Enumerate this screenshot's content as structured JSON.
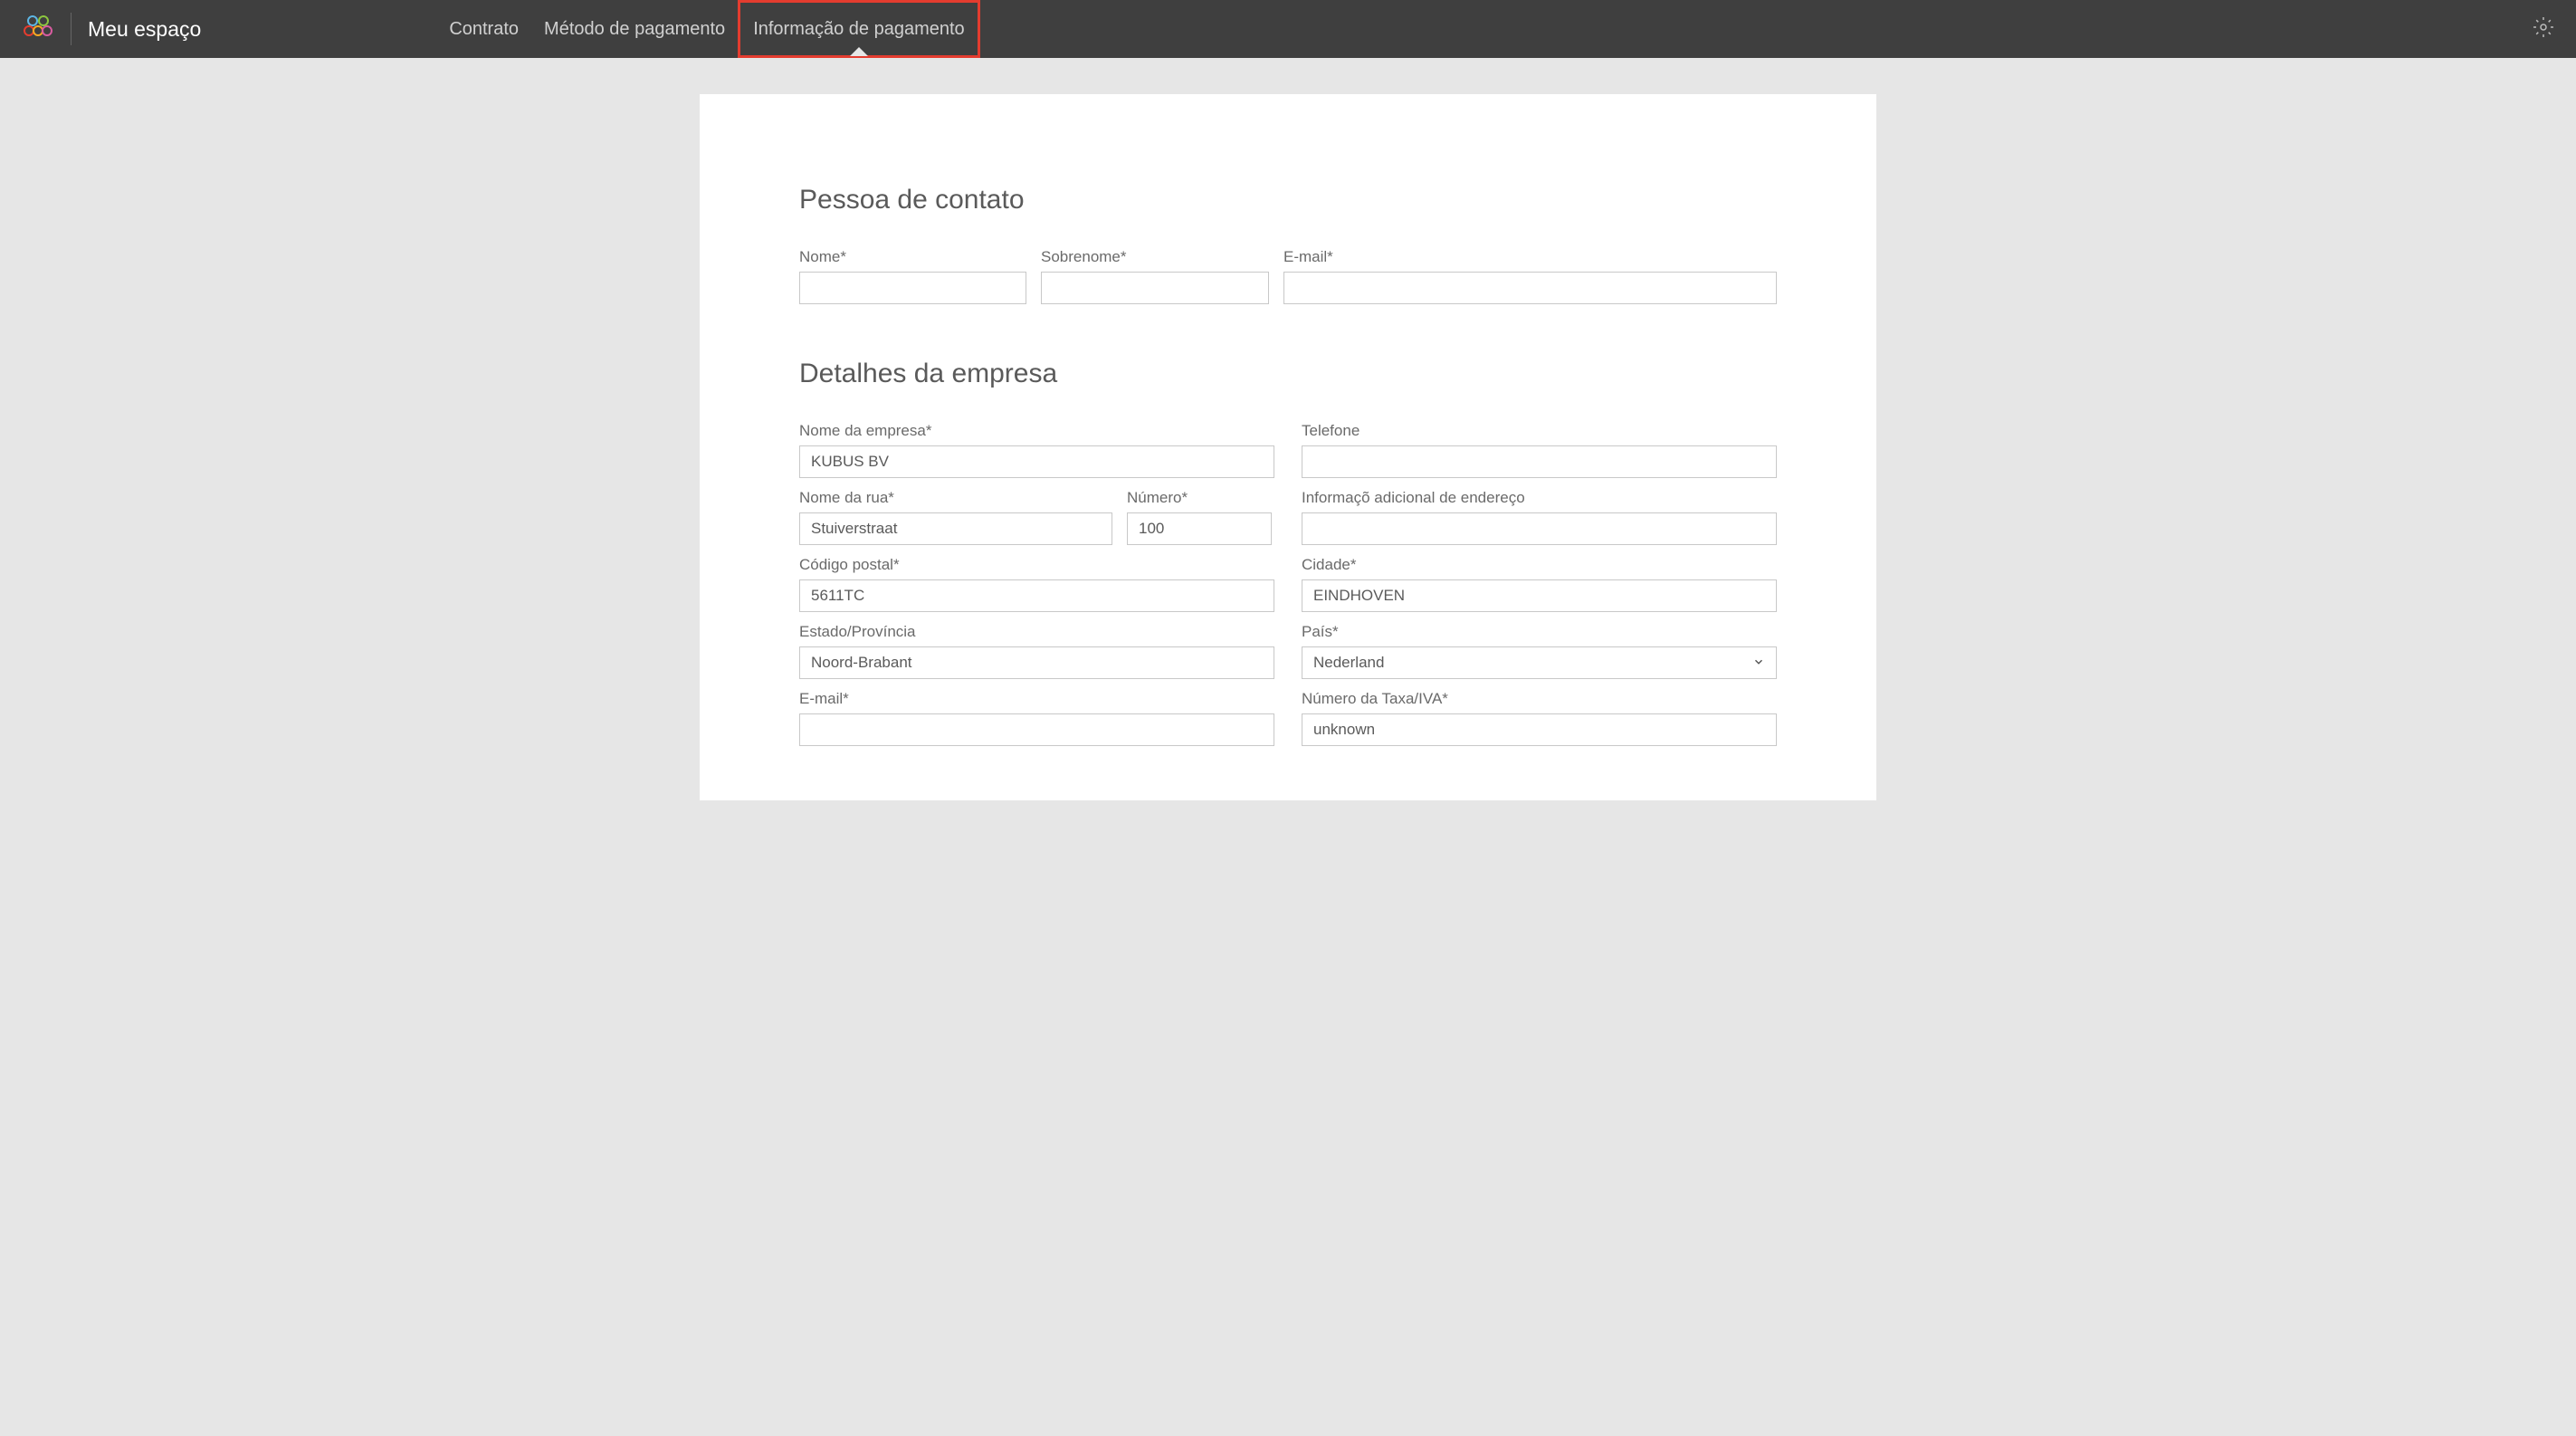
{
  "header": {
    "title": "Meu espaço",
    "tabs": [
      {
        "label": "Contrato",
        "active": false,
        "highlighted": false
      },
      {
        "label": "Método de pagamento",
        "active": false,
        "highlighted": false
      },
      {
        "label": "Informação de pagamento",
        "active": true,
        "highlighted": true
      }
    ]
  },
  "sections": {
    "contact": {
      "title": "Pessoa de contato",
      "fields": {
        "firstName": {
          "label": "Nome*",
          "value": ""
        },
        "lastName": {
          "label": "Sobrenome*",
          "value": ""
        },
        "email": {
          "label": "E-mail*",
          "value": ""
        }
      }
    },
    "company": {
      "title": "Detalhes da empresa",
      "fields": {
        "companyName": {
          "label": "Nome da empresa*",
          "value": "KUBUS BV"
        },
        "phone": {
          "label": "Telefone",
          "value": ""
        },
        "street": {
          "label": "Nome da rua*",
          "value": "Stuiverstraat"
        },
        "number": {
          "label": "Número*",
          "value": "100"
        },
        "addressExtra": {
          "label": "Informaçõ adicional de endereço",
          "value": ""
        },
        "postalCode": {
          "label": "Código postal*",
          "value": "5611TC"
        },
        "city": {
          "label": "Cidade*",
          "value": "EINDHOVEN"
        },
        "state": {
          "label": "Estado/Província",
          "value": "Noord-Brabant"
        },
        "country": {
          "label": "País*",
          "value": "Nederland"
        },
        "email": {
          "label": "E-mail*",
          "value": ""
        },
        "vat": {
          "label": "Número da Taxa/IVA*",
          "value": "unknown"
        }
      }
    }
  }
}
